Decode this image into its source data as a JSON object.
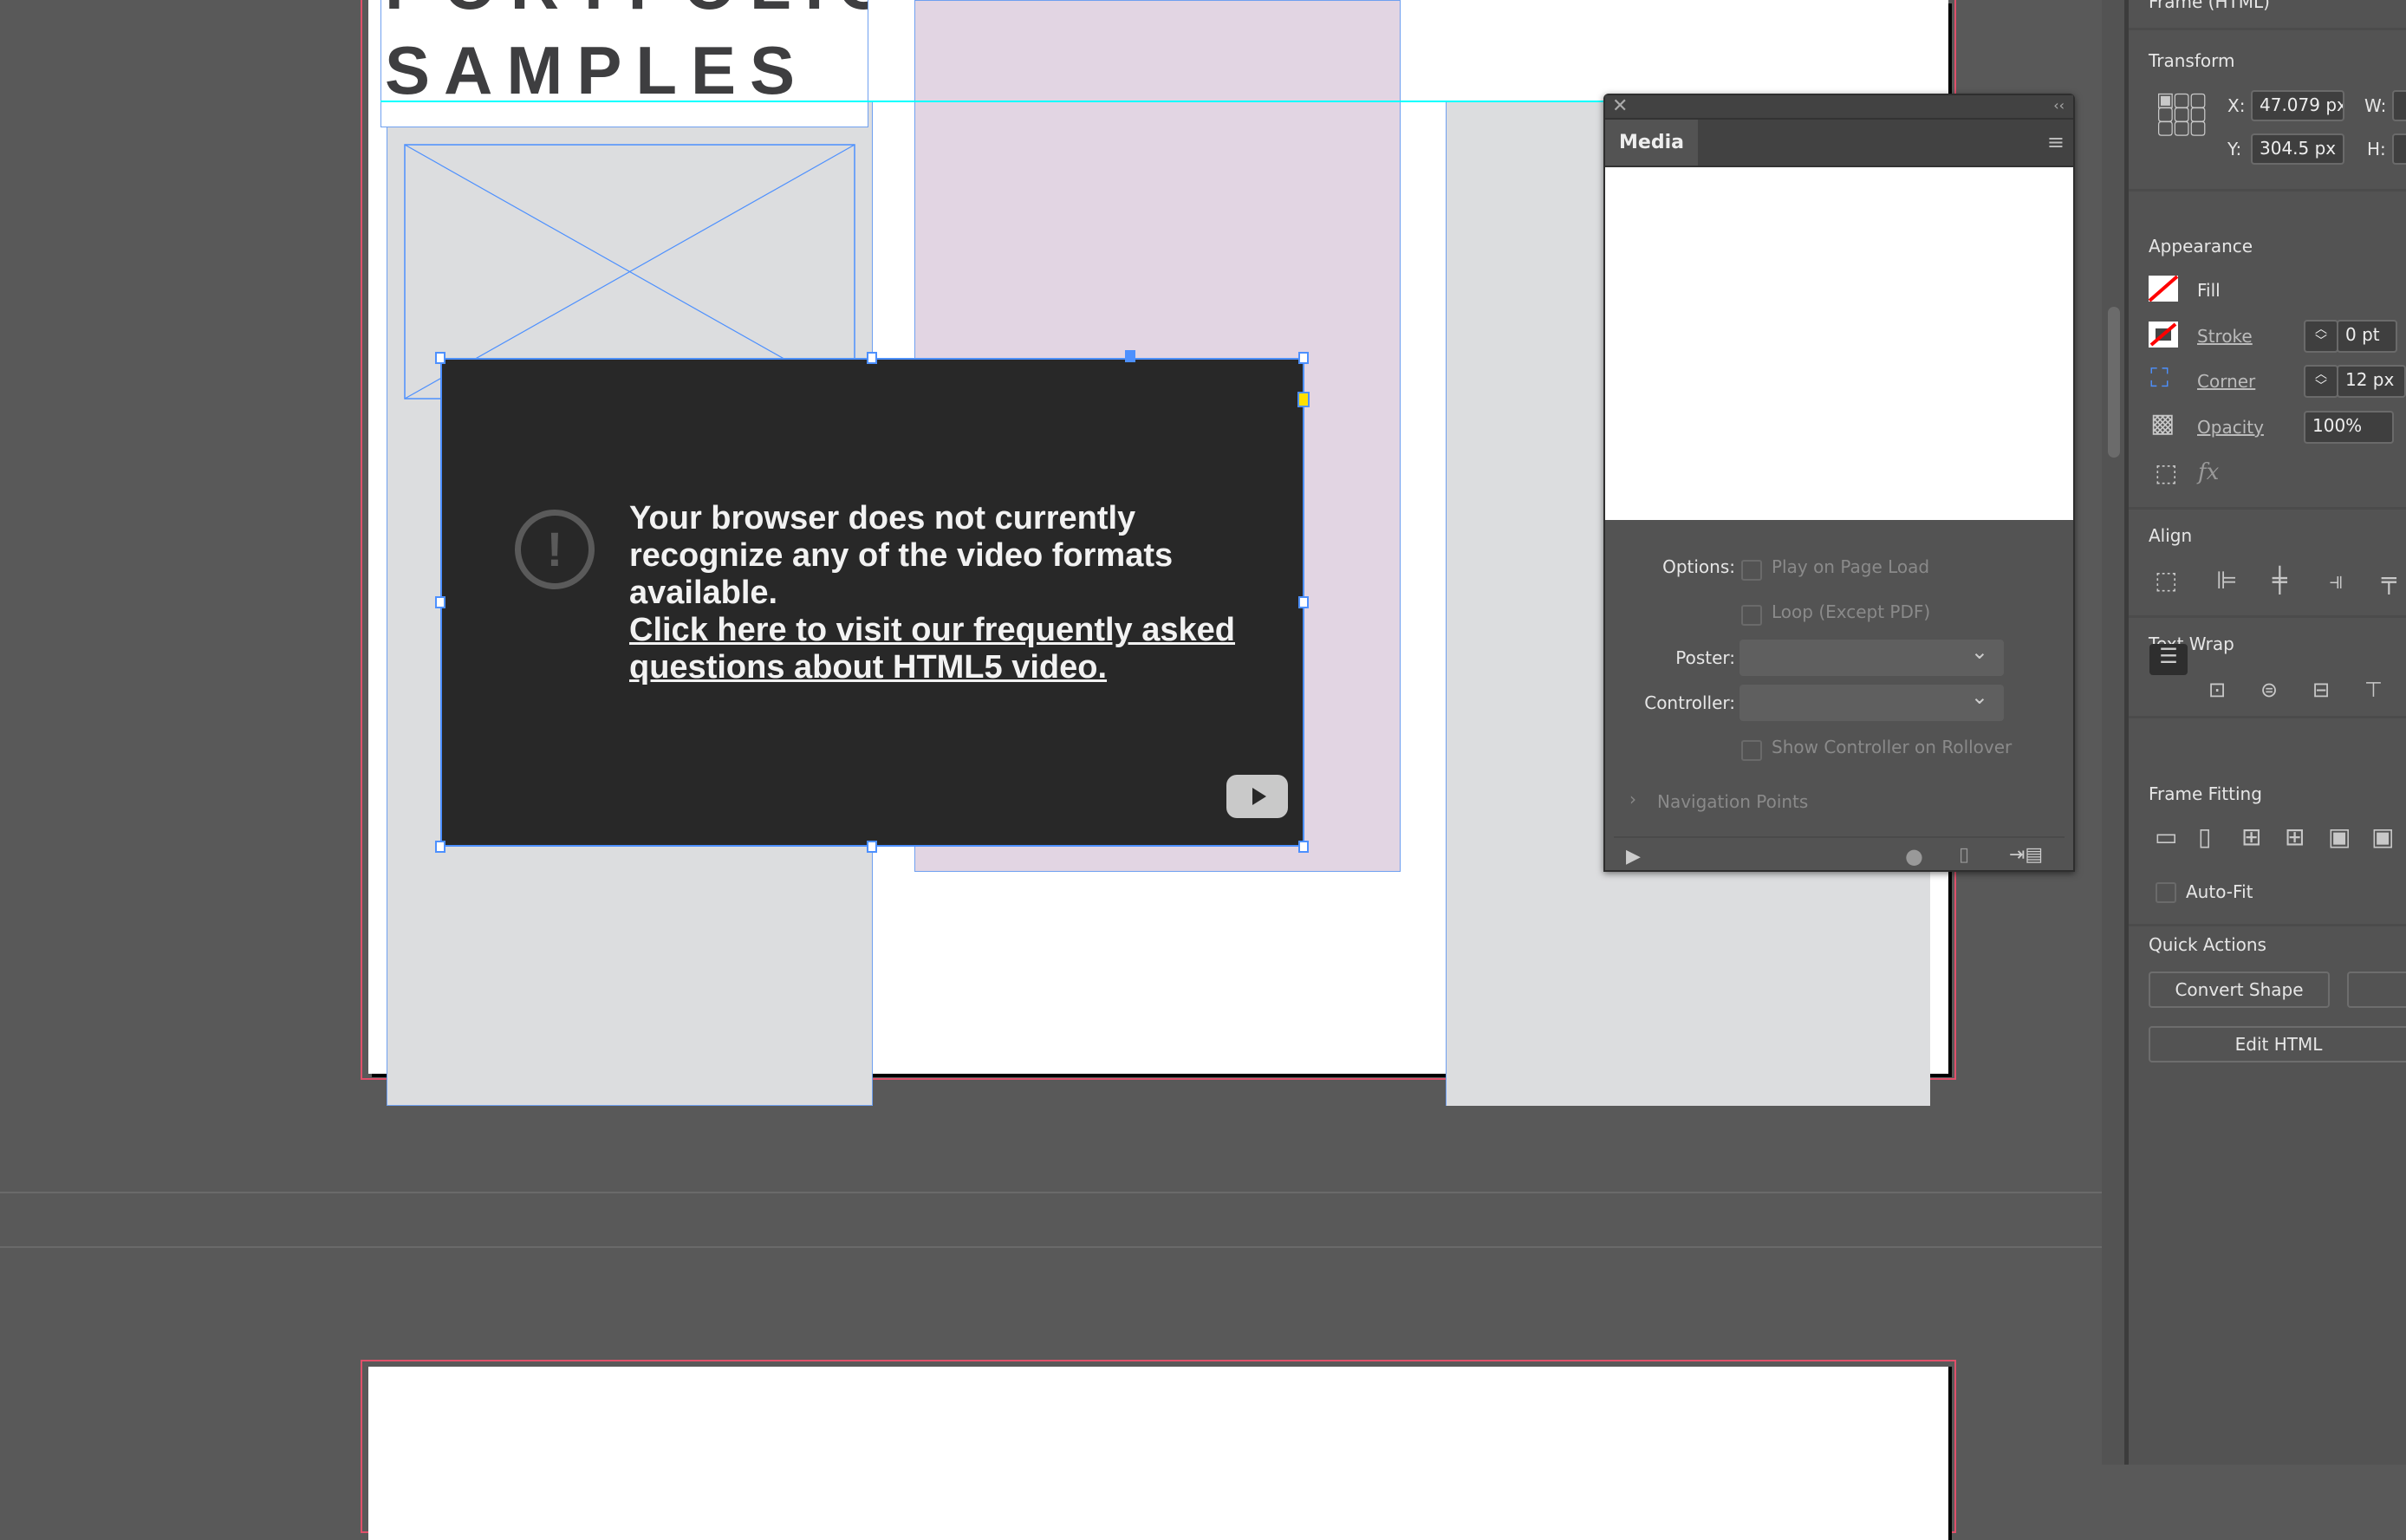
{
  "document": {
    "heading_line1": "PORTFOLIO",
    "heading_line2": "SAMPLES",
    "video_message": "Your browser does not currently recognize any of the video formats available.",
    "video_link": "Click here to visit our frequently asked questions about HTML5 video."
  },
  "media_panel": {
    "tab": "Media",
    "options_label": "Options:",
    "play_on_load": "Play on Page Load",
    "loop": "Loop (Except PDF)",
    "poster_label": "Poster:",
    "poster_value": "",
    "controller_label": "Controller:",
    "controller_value": "",
    "show_controller": "Show Controller on Rollover",
    "navigation_points": "Navigation Points"
  },
  "properties": {
    "header": "Frame (HTML)",
    "transform": {
      "title": "Transform",
      "x_label": "X:",
      "x_value": "47.079 px",
      "y_label": "Y:",
      "y_value": "304.5 px",
      "w_label": "W:",
      "h_label": "H:"
    },
    "appearance": {
      "title": "Appearance",
      "fill": "Fill",
      "stroke": "Stroke",
      "stroke_value": "0 pt",
      "corner": "Corner",
      "corner_value": "12 px",
      "opacity": "Opacity",
      "opacity_value": "100%",
      "fx": "fx"
    },
    "align": {
      "title": "Align"
    },
    "text_wrap": {
      "title": "Text Wrap"
    },
    "frame_fitting": {
      "title": "Frame Fitting",
      "auto_fit": "Auto-Fit"
    },
    "quick_actions": {
      "title": "Quick Actions",
      "convert_shape": "Convert Shape",
      "edit_html": "Edit HTML"
    }
  },
  "colors": {
    "accent": "#4d90fe",
    "guide": "#00ffff",
    "bleed": "#e0506a",
    "pink_frame": "#e2d5e3",
    "gray_frame": "#dcdddf",
    "video_bg": "#282828"
  }
}
